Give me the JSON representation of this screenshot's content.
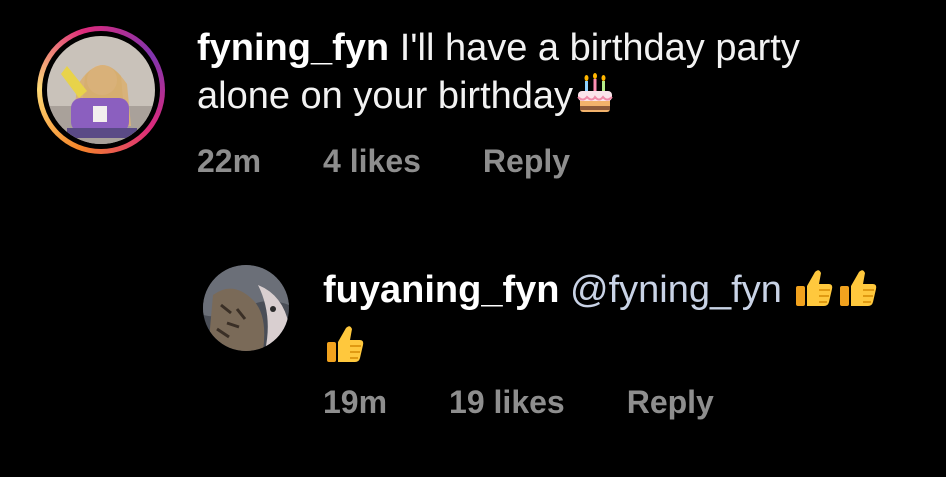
{
  "comments": [
    {
      "username": "fyning_fyn",
      "text": "I'll have a birthday party alone on your birthday",
      "emoji": "birthday-cake-emoji",
      "time": "22m",
      "likes": "4 likes",
      "reply": "Reply"
    },
    {
      "username": "fuyaning_fyn",
      "mention": "@fyning_fyn",
      "emoji": "thumbs-up-emoji",
      "emoji_count": 3,
      "time": "19m",
      "likes": "19 likes",
      "reply": "Reply"
    }
  ],
  "colors": {
    "background": "#000000",
    "text": "#f2f2f2",
    "meta": "#8e8e8e",
    "mention": "#c9d3e6",
    "story_ring": [
      "#f58529",
      "#dd2a7b",
      "#8134af"
    ]
  }
}
